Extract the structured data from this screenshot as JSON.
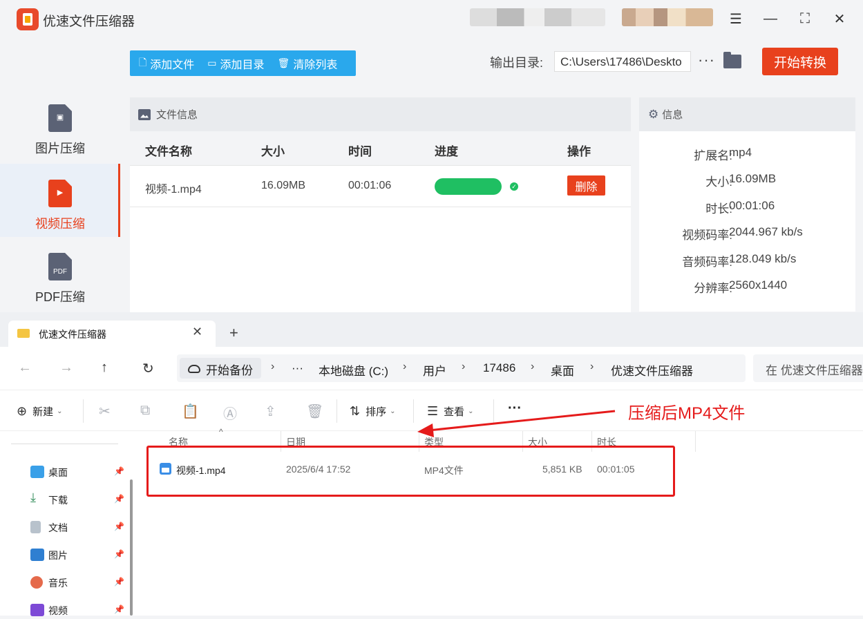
{
  "app": {
    "title": "优速文件压缩器",
    "accent_color": "#e8411d",
    "toolbar": {
      "add_file": "添加文件",
      "add_folder": "添加目录",
      "clear_list": "清除列表"
    },
    "output": {
      "label": "输出目录:",
      "path": "C:\\Users\\17486\\Deskto",
      "more": "···"
    },
    "start_button": "开始转换",
    "sidebar": [
      {
        "label": "图片压缩",
        "icon": "image-file-icon",
        "active": false
      },
      {
        "label": "视频压缩",
        "icon": "video-file-icon",
        "active": true
      },
      {
        "label": "PDF压缩",
        "icon": "pdf-file-icon",
        "badge": "PDF",
        "active": false
      }
    ],
    "file_panel": {
      "title": "文件信息",
      "columns": [
        "文件名称",
        "大小",
        "时间",
        "进度",
        "操作"
      ],
      "rows": [
        {
          "name": "视频-1.mp4",
          "size": "16.09MB",
          "time": "00:01:06",
          "progress": 1.0,
          "action": "删除"
        }
      ]
    },
    "info_panel": {
      "title": "信息",
      "rows": [
        {
          "key": "扩展名:",
          "value": "mp4"
        },
        {
          "key": "大小:",
          "value": "16.09MB"
        },
        {
          "key": "时长:",
          "value": "00:01:06"
        },
        {
          "key": "视频码率:",
          "value": "2044.967 kb/s"
        },
        {
          "key": "音频码率:",
          "value": "128.049 kb/s"
        },
        {
          "key": "分辨率:",
          "value": "2560x1440"
        }
      ]
    }
  },
  "explorer": {
    "tab_title": "优速文件压缩器",
    "address": {
      "backup": "开始备份",
      "ellipsis": "···",
      "segments": [
        "本地磁盘 (C:)",
        "用户",
        "17486",
        "桌面",
        "优速文件压缩器"
      ]
    },
    "search_placeholder": "在 优速文件压缩器",
    "commands": {
      "new": "新建",
      "sort": "排序",
      "view": "查看",
      "more": "···"
    },
    "nav_items": [
      {
        "label": "桌面",
        "icon": "desktop-icon",
        "color": "#3aa0e8"
      },
      {
        "label": "下载",
        "icon": "download-icon",
        "color": "#2e8b57"
      },
      {
        "label": "文档",
        "icon": "document-icon",
        "color": "#7a8899"
      },
      {
        "label": "图片",
        "icon": "pictures-icon",
        "color": "#2f7fd1"
      },
      {
        "label": "音乐",
        "icon": "music-icon",
        "color": "#e56a4b"
      },
      {
        "label": "视频",
        "icon": "videos-icon",
        "color": "#7d4ad6"
      }
    ],
    "columns": [
      "名称",
      "日期",
      "类型",
      "大小",
      "时长"
    ],
    "files": [
      {
        "name": "视频-1.mp4",
        "date": "2025/6/4 17:52",
        "type": "MP4文件",
        "size": "5,851 KB",
        "duration": "00:01:05"
      }
    ]
  },
  "annotation": {
    "text": "压缩后MP4文件",
    "color": "#e51b1b"
  }
}
